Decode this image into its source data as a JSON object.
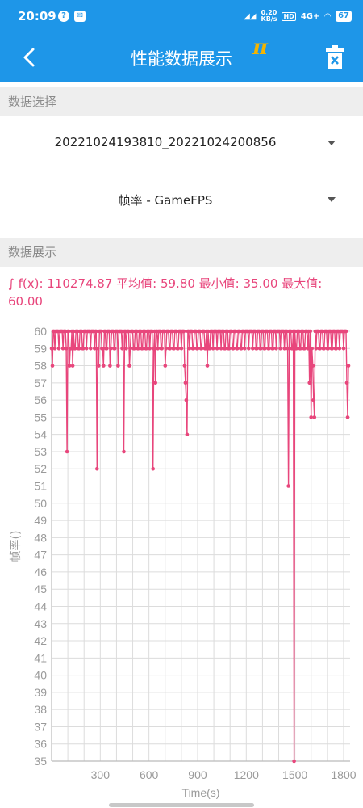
{
  "status_bar": {
    "time": "20:09",
    "network_speed": "0.20",
    "network_unit": "KB/s",
    "hd": "HD",
    "signal": "4G+",
    "battery": "67",
    "icons": [
      "help-icon",
      "mail-icon",
      "signal-icon",
      "wifi-icon",
      "battery-icon"
    ]
  },
  "app_bar": {
    "title": "性能数据展示",
    "back_icon": "back-arrow-icon",
    "action_icon": "delete-icon",
    "accent_color": "#1e96e8"
  },
  "data_select": {
    "header": "数据选择",
    "file_value": "20221024193810_20221024200856",
    "metric_value": "帧率 - GameFPS"
  },
  "data_display": {
    "header": "数据展示",
    "stats_text": "∫ f(x): 110274.87 平均值: 59.80 最小值: 35.00 最大值: 60.00"
  },
  "chart_data": {
    "type": "line",
    "xlabel": "Time(s)",
    "ylabel": "帧率()",
    "x_ticks": [
      300,
      600,
      900,
      1200,
      1500,
      1800
    ],
    "y_ticks": [
      35,
      36,
      37,
      38,
      39,
      40,
      41,
      42,
      43,
      44,
      45,
      46,
      47,
      48,
      49,
      50,
      51,
      52,
      53,
      54,
      55,
      56,
      57,
      58,
      59,
      60
    ],
    "xlim": [
      0,
      1840
    ],
    "ylim": [
      35,
      60
    ],
    "grid": true,
    "color": "#e8467c",
    "baseline_values": [
      59,
      60
    ],
    "dips": [
      {
        "x": 5,
        "y": 58
      },
      {
        "x": 95,
        "y": 53
      },
      {
        "x": 110,
        "y": 58
      },
      {
        "x": 130,
        "y": 58
      },
      {
        "x": 280,
        "y": 52
      },
      {
        "x": 290,
        "y": 58
      },
      {
        "x": 320,
        "y": 58
      },
      {
        "x": 360,
        "y": 58
      },
      {
        "x": 410,
        "y": 58
      },
      {
        "x": 445,
        "y": 53
      },
      {
        "x": 480,
        "y": 58
      },
      {
        "x": 625,
        "y": 52
      },
      {
        "x": 640,
        "y": 57
      },
      {
        "x": 700,
        "y": 58
      },
      {
        "x": 820,
        "y": 58
      },
      {
        "x": 825,
        "y": 57
      },
      {
        "x": 830,
        "y": 56
      },
      {
        "x": 835,
        "y": 54
      },
      {
        "x": 960,
        "y": 58
      },
      {
        "x": 1460,
        "y": 51
      },
      {
        "x": 1495,
        "y": 35
      },
      {
        "x": 1590,
        "y": 57
      },
      {
        "x": 1600,
        "y": 55
      },
      {
        "x": 1610,
        "y": 58
      },
      {
        "x": 1615,
        "y": 56
      },
      {
        "x": 1620,
        "y": 55
      },
      {
        "x": 1820,
        "y": 57
      },
      {
        "x": 1825,
        "y": 55
      },
      {
        "x": 1830,
        "y": 58
      }
    ]
  }
}
